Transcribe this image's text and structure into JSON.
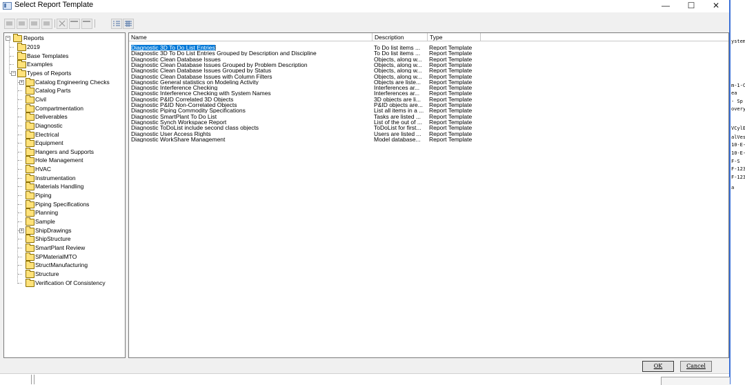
{
  "window": {
    "title": "Select Report Template",
    "minimize_glyph": "—",
    "maximize_glyph": "☐",
    "close_glyph": "✕"
  },
  "toolbar": {
    "buttons": [
      "new-folder-icon",
      "new-template-icon",
      "copy-template-icon",
      "delete-icon",
      "close-icon",
      "rename-icon",
      "properties-icon",
      "list-view-icon",
      "details-view-icon"
    ]
  },
  "tree": {
    "root": "Reports",
    "items": [
      {
        "label": "2019",
        "level": 1
      },
      {
        "label": "Base Templates",
        "level": 1
      },
      {
        "label": "Examples",
        "level": 1
      },
      {
        "label": "Types of Reports",
        "level": 1
      },
      {
        "label": "Catalog Engineering Checks",
        "level": 2
      },
      {
        "label": "Catalog Parts",
        "level": 2
      },
      {
        "label": "Civil",
        "level": 2
      },
      {
        "label": "Compartmentation",
        "level": 2
      },
      {
        "label": "Deliverables",
        "level": 2
      },
      {
        "label": "Diagnostic",
        "level": 2
      },
      {
        "label": "Electrical",
        "level": 2
      },
      {
        "label": "Equipment",
        "level": 2
      },
      {
        "label": "Hangers and Supports",
        "level": 2
      },
      {
        "label": "Hole Management",
        "level": 2
      },
      {
        "label": "HVAC",
        "level": 2
      },
      {
        "label": "Instrumentation",
        "level": 2
      },
      {
        "label": "Materials Handling",
        "level": 2
      },
      {
        "label": "Piping",
        "level": 2
      },
      {
        "label": "Piping Specifications",
        "level": 2
      },
      {
        "label": "Planning",
        "level": 2
      },
      {
        "label": "Sample",
        "level": 2
      },
      {
        "label": "ShipDrawings",
        "level": 2
      },
      {
        "label": "ShipStructure",
        "level": 2
      },
      {
        "label": "SmartPlant Review",
        "level": 2
      },
      {
        "label": "SPMaterialMTO",
        "level": 2
      },
      {
        "label": "StructManufacturing",
        "level": 2
      },
      {
        "label": "Structure",
        "level": 2
      },
      {
        "label": "Verification Of Consistency",
        "level": 2
      }
    ]
  },
  "list": {
    "columns": [
      "Name",
      "Description",
      "Type"
    ],
    "rows": [
      [
        "Diagnostic 3D To Do List Entries",
        "To Do list items ...",
        "Report Template"
      ],
      [
        "Diagnostic 3D To Do List Entries Grouped by Description and Discipline",
        "To Do list items ...",
        "Report Template"
      ],
      [
        "Diagnostic Clean Database Issues",
        "Objects, along w...",
        "Report Template"
      ],
      [
        "Diagnostic Clean Database Issues Grouped by Problem Description",
        "Objects, along w...",
        "Report Template"
      ],
      [
        "Diagnostic Clean Database Issues Grouped by Status",
        "Objects, along w...",
        "Report Template"
      ],
      [
        "Diagnostic Clean Database Issues with Column Filters",
        "Objects, along w...",
        "Report Template"
      ],
      [
        "Diagnostic General statistics on Modeling Activity",
        "Objects are liste...",
        "Report Template"
      ],
      [
        "Diagnostic Interference Checking",
        "Interferences ar...",
        "Report Template"
      ],
      [
        "Diagnostic Interference Checking with System Names",
        "Interferences ar...",
        "Report Template"
      ],
      [
        "Diagnostic P&ID Correlated 3D Objects",
        "3D objects are li...",
        "Report Template"
      ],
      [
        "Diagnostic P&ID Non-Correlated Objects",
        "P&ID objects are...",
        "Report Template"
      ],
      [
        "Diagnostic Piping Commodity Specifications",
        "List all items in a ...",
        "Report Template"
      ],
      [
        "Diagnostic SmartPlant To Do List",
        "Tasks are listed ...",
        "Report Template"
      ],
      [
        "Diagnostic Synch Workspace Report",
        "List of the out of ...",
        "Report Template"
      ],
      [
        "Diagnostic ToDoList include second class objects",
        "ToDoList for first...",
        "Report Template"
      ],
      [
        "Diagnostic User Access Rights",
        "Users are listed ...",
        "Report Template"
      ],
      [
        "Diagnostic WorkShare Management",
        "Model database...",
        "Report Template"
      ]
    ]
  },
  "buttons": {
    "ok": "OK",
    "cancel": "Cancel"
  },
  "console_lines": [
    "ystem",
    "m-1-C",
    "ea",
    " - Sp",
    "overy",
    "VCylE",
    "alVes",
    "10-E-",
    "10-E-",
    "F-S",
    "F-123",
    "F-123",
    "a"
  ]
}
